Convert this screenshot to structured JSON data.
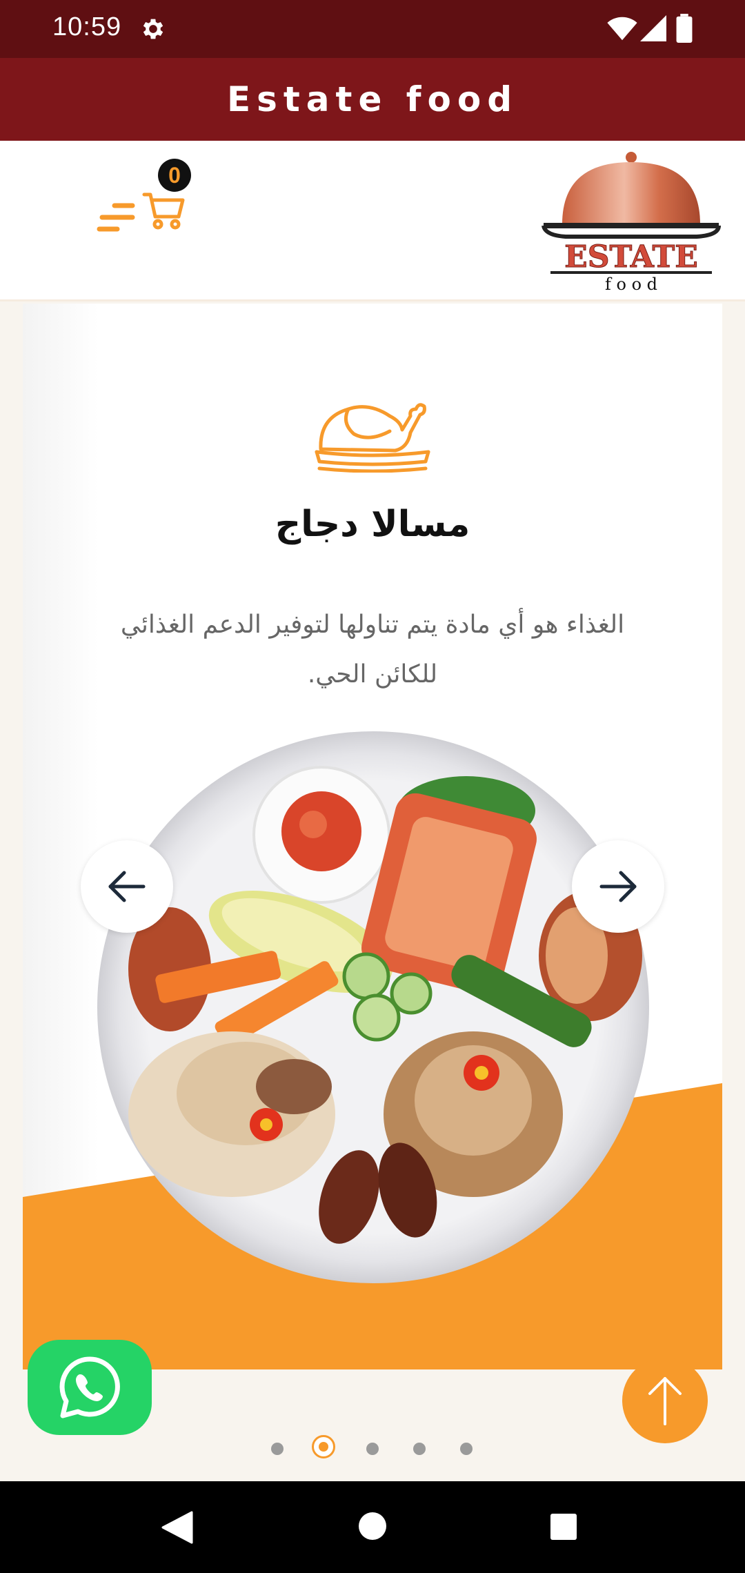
{
  "status_bar": {
    "time": "10:59"
  },
  "app_bar": {
    "title": "Estate food"
  },
  "header": {
    "cart_count": "0",
    "logo": {
      "word": "ESTATE",
      "sub": "f o o d"
    }
  },
  "slide": {
    "icon": "roast-chicken-icon",
    "title": "مسالا دجاج",
    "description": "الغذاء هو أي مادة يتم تناولها لتوفير الدعم الغذائي للكائن الحي."
  },
  "pagination": {
    "count": 5,
    "active_index": 1
  },
  "colors": {
    "status_bar": "#5f0f12",
    "app_bar": "#7e161a",
    "accent_orange": "#f79a2b",
    "whatsapp_green": "#25d366",
    "page_bg": "#f8f4ee"
  },
  "icons": {
    "menu": "menu-lines-icon",
    "cart": "cart-icon",
    "prev": "arrow-left-icon",
    "next": "arrow-right-icon",
    "whatsapp": "whatsapp-icon",
    "scroll_top": "arrow-up-icon"
  }
}
